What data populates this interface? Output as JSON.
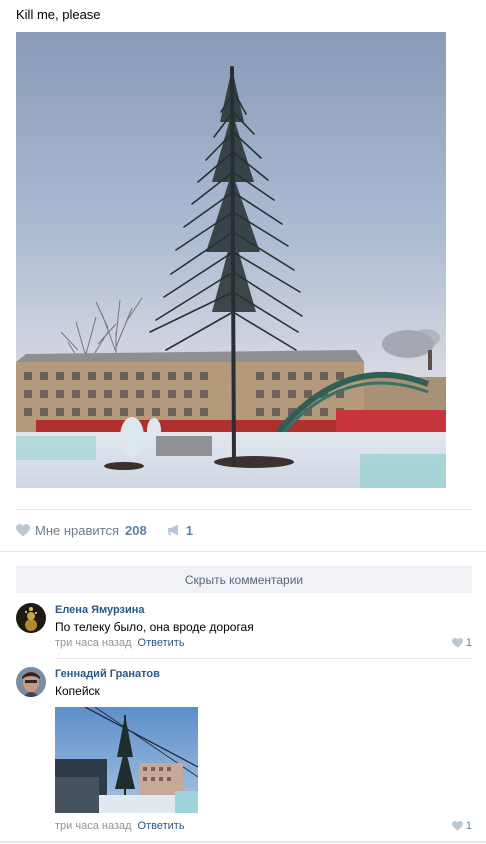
{
  "post": {
    "text": "Kill me, please",
    "likes_label": "Мне нравится",
    "likes_count": "208",
    "shares_count": "1"
  },
  "hide_comments_label": "Скрыть комментарии",
  "comments": [
    {
      "author": "Елена Ямурзина",
      "text": "По телеку было, она вроде дорогая",
      "time": "три часа назад",
      "reply_label": "Ответить",
      "likes": "1"
    },
    {
      "author": "Геннадий Гранатов",
      "text": "Копейск",
      "time": "три часа назад",
      "reply_label": "Ответить",
      "likes": "1"
    }
  ],
  "colors": {
    "link": "#2a5885",
    "action": "#5e81a8",
    "meta": "#939393",
    "button_bg": "#f0f2f5"
  }
}
